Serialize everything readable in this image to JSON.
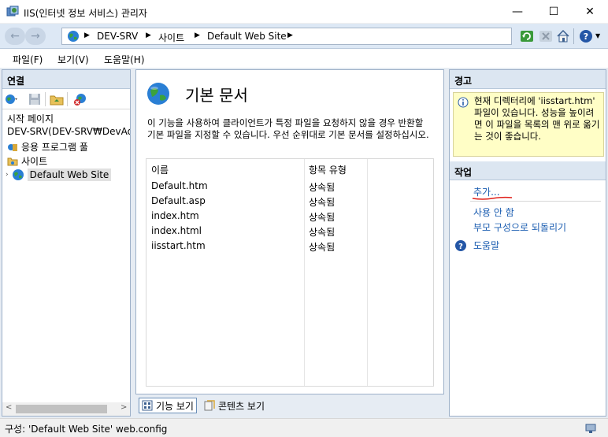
{
  "window": {
    "title": "IIS(인터넷 정보 서비스) 관리자",
    "minimize": "—",
    "maximize": "☐",
    "close": "✕"
  },
  "addressbar": {
    "back": "←",
    "forward": "→",
    "breadcrumbs": [
      "DEV-SRV",
      "사이트",
      "Default Web Site"
    ],
    "icons": [
      "refresh-icon",
      "stop-icon",
      "home-icon",
      "help-icon"
    ]
  },
  "menu": {
    "items": [
      "파일(F)",
      "보기(V)",
      "도움말(H)"
    ]
  },
  "connections": {
    "header": "연결",
    "tree": [
      {
        "label": "시작 페이지",
        "icon": "start-page-icon"
      },
      {
        "label": "DEV-SRV(DEV-SRV₩DevAdmin)",
        "icon": "server-icon"
      },
      {
        "label": "응용 프로그램 풀",
        "icon": "app-pool-icon"
      },
      {
        "label": "사이트",
        "icon": "folder-icon"
      },
      {
        "label": "Default Web Site",
        "icon": "globe-icon",
        "selected": true
      }
    ],
    "scroll_left": "<",
    "scroll_right": ">"
  },
  "feature": {
    "title": "기본 문서",
    "description": "이 기능을 사용하여 클라이언트가 특정 파일을 요청하지 않을 경우 반환할 기본 파일을 지정할 수 있습니다. 우선 순위대로 기본 문서를 설정하십시오.",
    "columns": [
      "이름",
      "항목 유형"
    ],
    "rows": [
      {
        "name": "Default.htm",
        "type": "상속됨"
      },
      {
        "name": "Default.asp",
        "type": "상속됨"
      },
      {
        "name": "index.htm",
        "type": "상속됨"
      },
      {
        "name": "index.html",
        "type": "상속됨"
      },
      {
        "name": "iisstart.htm",
        "type": "상속됨"
      }
    ]
  },
  "viewtabs": {
    "features": "기능 보기",
    "content": "콘텐츠 보기"
  },
  "alerts": {
    "header": "경고",
    "message": "현재 디렉터리에 'iisstart.htm' 파일이 있습니다. 성능을 높이려면 이 파일을 목록의 맨 위로 옮기는 것이 좋습니다."
  },
  "actions": {
    "header": "작업",
    "add": "추가...",
    "disable": "사용 안 함",
    "revert": "부모 구성으로 되돌리기",
    "help": "도움말"
  },
  "status": {
    "text": "구성: 'Default Web Site' web.config"
  },
  "colors": {
    "accent_link": "#1a5cb0",
    "pane_header": "#dce6f1",
    "alert_bg": "#fffec6",
    "annotation_red": "#e0201a"
  }
}
